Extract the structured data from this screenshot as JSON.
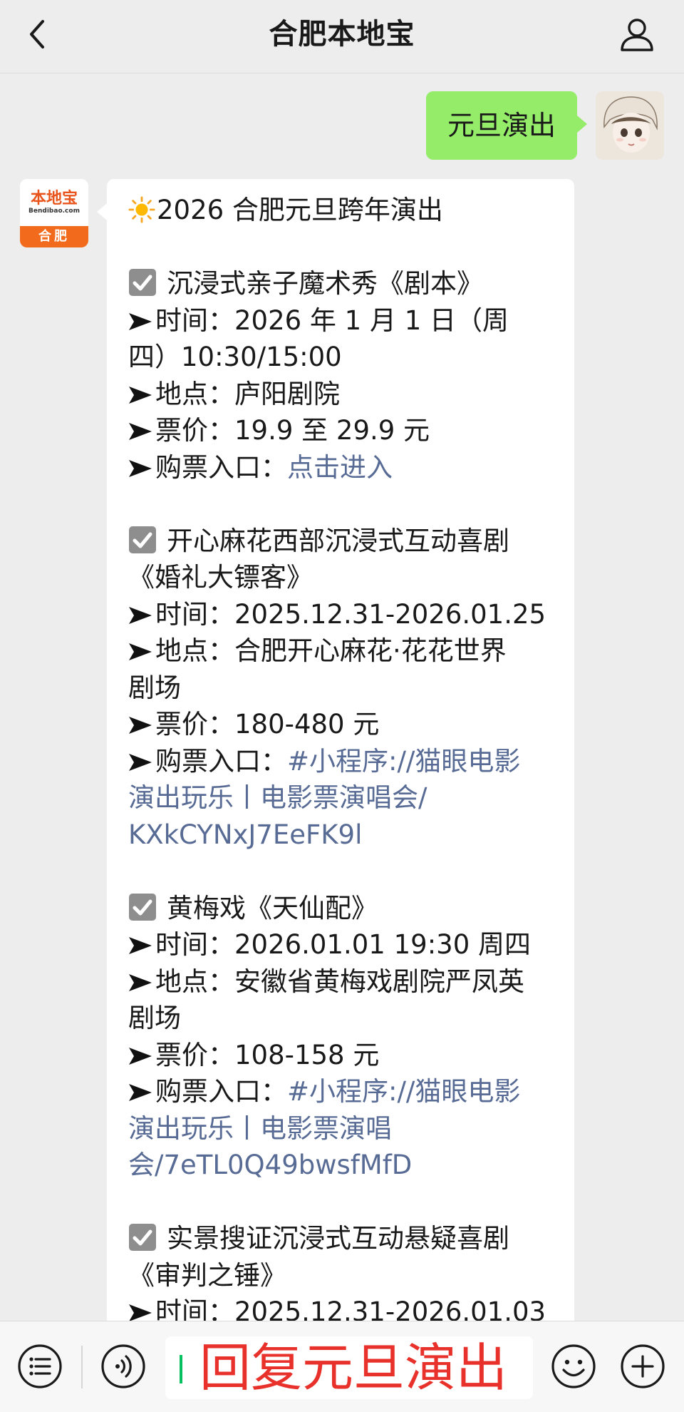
{
  "header": {
    "title": "合肥本地宝"
  },
  "messages": {
    "outgoing": {
      "text": "元旦演出"
    },
    "logo": {
      "main": "本地宝",
      "sub": "Bendibao.com",
      "city": "合肥"
    },
    "incoming": {
      "title": "2026 合肥元旦跨年演出",
      "items": [
        {
          "name": "沉浸式亲子魔术秀《剧本》",
          "time_label": "时间：",
          "time": "2026 年 1 月 1 日（周",
          "time_cont": "四）10:30/15:00",
          "venue_label": "地点：",
          "venue": "庐阳剧院",
          "venue_cont": "",
          "price_label": "票价：",
          "price": "19.9 至 29.9 元",
          "ticket_label": "购票入口：",
          "ticket_link": "点击进入",
          "ticket_link_2": "",
          "ticket_link_3": ""
        },
        {
          "name": "开心麻花西部沉浸式互动喜剧",
          "name_cont": "《婚礼大镖客》",
          "time_label": "时间：",
          "time": "2025.12.31-2026.01.25",
          "venue_label": "地点：",
          "venue": "合肥开心麻花·花花世界",
          "venue_cont": "剧场",
          "price_label": "票价：",
          "price": "180-480 元",
          "ticket_label": "购票入口：",
          "ticket_link": "#小程序://猫眼电影",
          "ticket_link_2": "演出玩乐丨电影票演唱会/",
          "ticket_link_3": "KXkCYNxJ7EeFK9l"
        },
        {
          "name": "黄梅戏《天仙配》",
          "time_label": "时间：",
          "time": "2026.01.01 19:30 周四",
          "venue_label": "地点：",
          "venue": "安徽省黄梅戏剧院严凤英",
          "venue_cont": "剧场",
          "price_label": "票价：",
          "price": "108-158 元",
          "ticket_label": "购票入口：",
          "ticket_link": "#小程序://猫眼电影",
          "ticket_link_2": "演出玩乐丨电影票演唱",
          "ticket_link_3": "会/7eTL0Q49bwsfMfD"
        },
        {
          "name": "实景搜证沉浸式互动悬疑喜剧",
          "name_cont": "《审判之锤》",
          "time_label": "时间：",
          "time": "2025.12.31-2026.01.03"
        }
      ]
    }
  },
  "input": {
    "text": "回复元旦演出"
  },
  "colors": {
    "bubble_out": "#95ec69",
    "link": "#576b95",
    "input_text": "#e8312b",
    "caret": "#07c160"
  }
}
